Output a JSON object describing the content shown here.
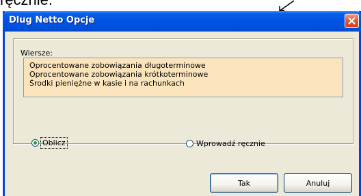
{
  "background_caption": "ręcznie.",
  "window": {
    "title": "Dlug Netto Opcje",
    "close_icon": "close-x-icon"
  },
  "rows": {
    "label": "Wiersze:",
    "items": [
      "Oprocentowane zobowiązania długoterminowe",
      "Oprocentowane zobowiązania krótkoterminowe",
      "Środki pieniężne w kasie i na rachunkach"
    ]
  },
  "options": {
    "calculate": {
      "label": "Oblicz",
      "selected": true
    },
    "manual": {
      "label": "Wprowadź ręcznie",
      "selected": false
    }
  },
  "buttons": {
    "ok": "Tak",
    "cancel": "Anuluj"
  },
  "colors": {
    "titlebar": "#0054e3",
    "window_bg": "#ece9d8",
    "list_bg": "#fbe3bb",
    "close_button": "#e3603f"
  }
}
